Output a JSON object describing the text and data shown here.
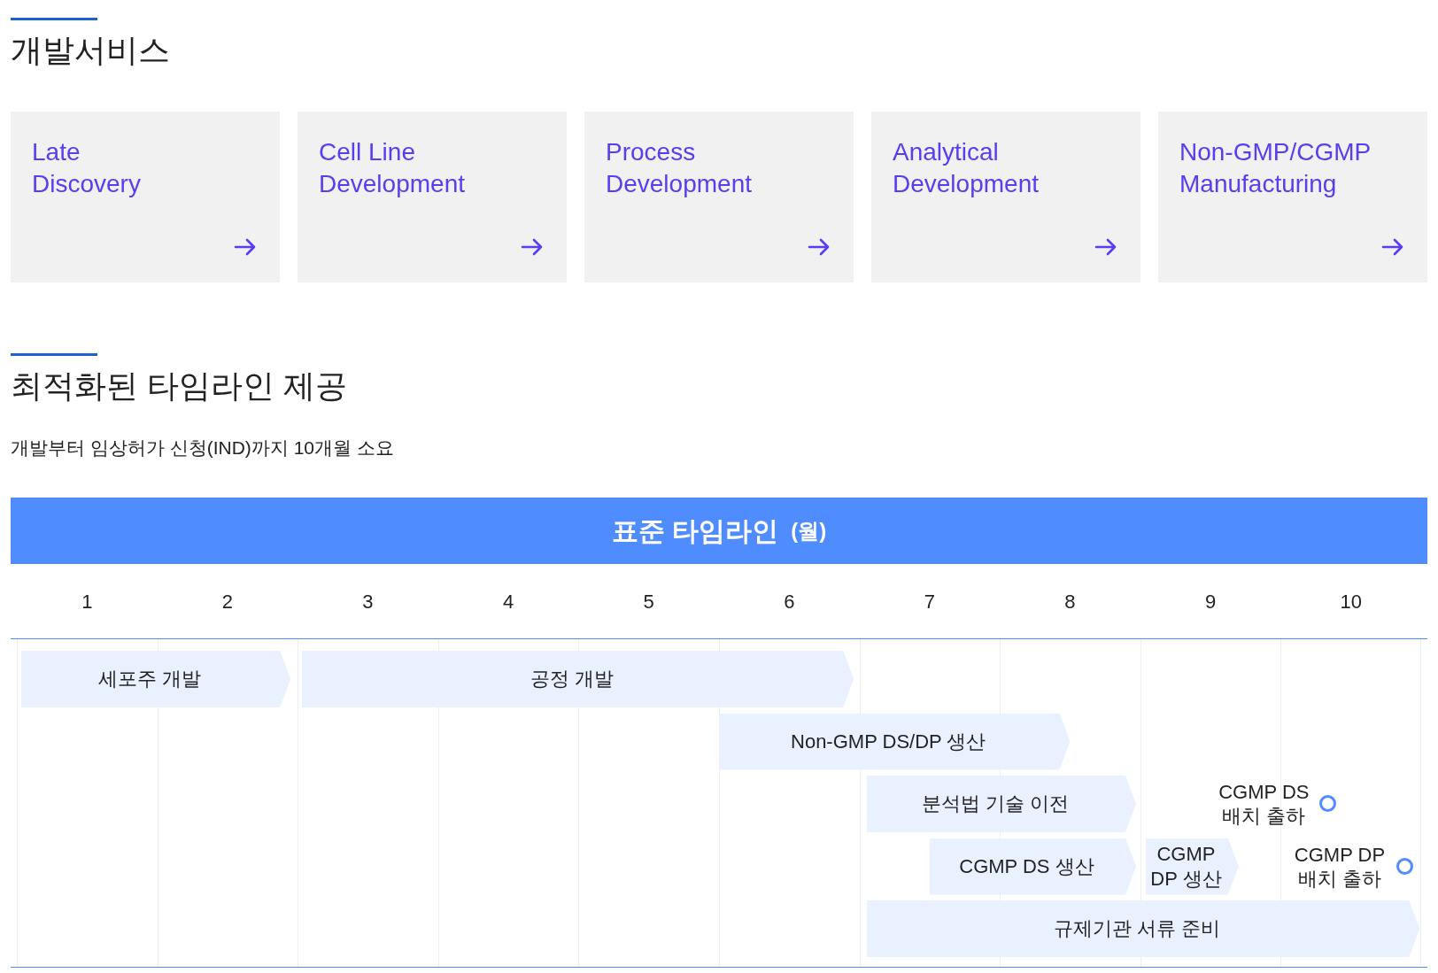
{
  "services": {
    "title": "개발서비스",
    "cards": [
      {
        "title_lines": [
          "Late",
          "Discovery"
        ]
      },
      {
        "title_lines": [
          "Cell Line",
          "Development"
        ]
      },
      {
        "title_lines": [
          "Process",
          "Development"
        ]
      },
      {
        "title_lines": [
          "Analytical",
          "Development"
        ]
      },
      {
        "title_lines": [
          "Non-GMP/CGMP",
          "Manufacturing"
        ]
      }
    ]
  },
  "timeline": {
    "title": "최적화된 타임라인 제공",
    "subtitle": "개발부터 임상허가 신청(IND)까지 10개월 소요",
    "banner": {
      "title": "표준 타임라인",
      "unit": "(월)"
    },
    "months": [
      "1",
      "2",
      "3",
      "4",
      "5",
      "6",
      "7",
      "8",
      "9",
      "10"
    ],
    "tasks": [
      {
        "kind": "bar",
        "lines": [
          "세포주 개발"
        ]
      },
      {
        "kind": "bar",
        "lines": [
          "공정 개발"
        ]
      },
      {
        "kind": "bar",
        "lines": [
          "Non-GMP DS/DP 생산"
        ]
      },
      {
        "kind": "bar",
        "lines": [
          "분석법 기술 이전"
        ]
      },
      {
        "kind": "milestone",
        "lines": [
          "CGMP DS",
          "배치 출하"
        ]
      },
      {
        "kind": "bar",
        "lines": [
          "CGMP DS 생산"
        ]
      },
      {
        "kind": "bar",
        "lines": [
          "CGMP",
          "DP 생산"
        ]
      },
      {
        "kind": "milestone",
        "lines": [
          "CGMP DP",
          "배치 출하"
        ]
      },
      {
        "kind": "bar",
        "lines": [
          "규제기관 서류 준비"
        ]
      }
    ]
  }
}
